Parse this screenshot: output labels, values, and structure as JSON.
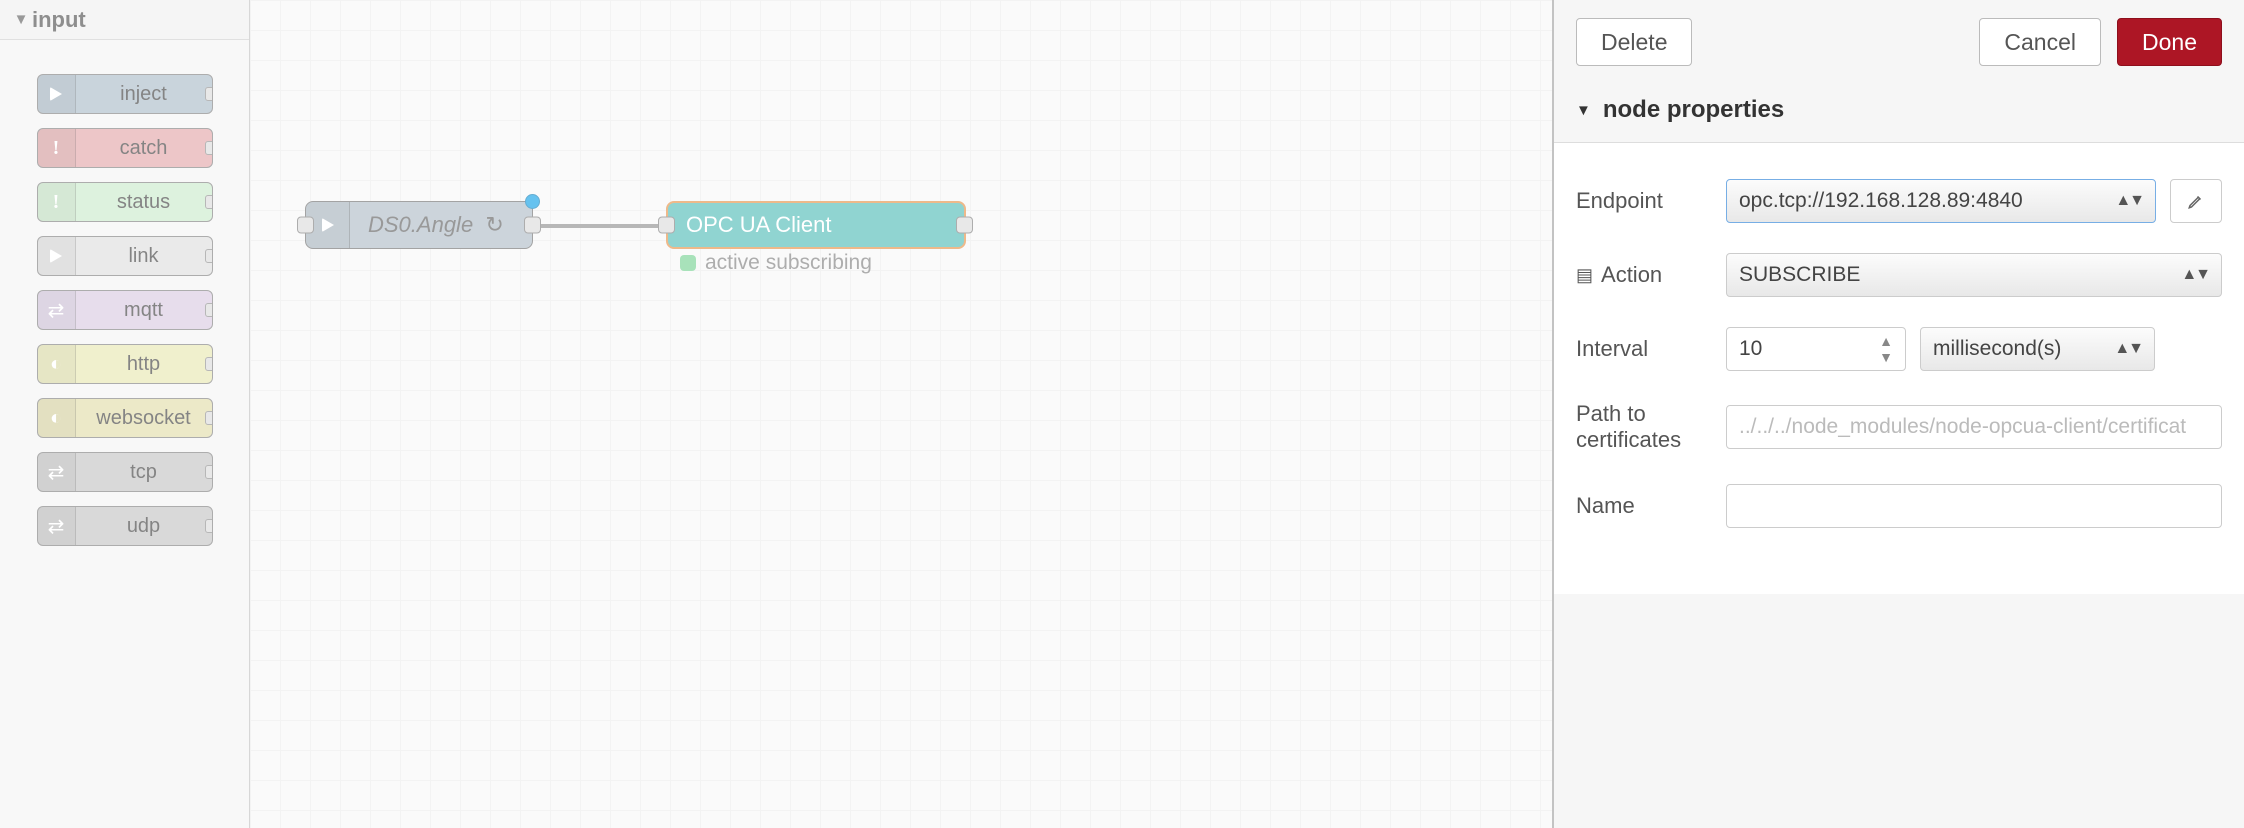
{
  "palette": {
    "category": "input",
    "nodes": [
      {
        "label": "inject",
        "color": "c-inject",
        "icon": "arrow"
      },
      {
        "label": "catch",
        "color": "c-catch",
        "icon": "bang"
      },
      {
        "label": "status",
        "color": "c-status",
        "icon": "bang"
      },
      {
        "label": "link",
        "color": "c-link",
        "icon": "arrow"
      },
      {
        "label": "mqtt",
        "color": "c-mqtt",
        "icon": "feed"
      },
      {
        "label": "http",
        "color": "c-http",
        "icon": "globe"
      },
      {
        "label": "websocket",
        "color": "c-websocket",
        "icon": "globe"
      },
      {
        "label": "tcp",
        "color": "c-tcp",
        "icon": "feed"
      },
      {
        "label": "udp",
        "color": "c-udp",
        "icon": "feed"
      }
    ]
  },
  "canvas": {
    "nodes": {
      "ds0": {
        "label": "DS0.Angle",
        "refresh_icon": "↻",
        "changed": true
      },
      "opcua": {
        "label": "OPC UA Client",
        "status_text": "active subscribing",
        "status_color": "#6fcf8c"
      }
    }
  },
  "panel": {
    "buttons": {
      "delete": "Delete",
      "cancel": "Cancel",
      "done": "Done"
    },
    "section_title": "node properties",
    "form": {
      "endpoint": {
        "label": "Endpoint",
        "value": "opc.tcp://192.168.128.89:4840"
      },
      "action": {
        "label": "Action",
        "value": "SUBSCRIBE"
      },
      "interval": {
        "label": "Interval",
        "value": "10",
        "unit": "millisecond(s)"
      },
      "certpath": {
        "label": "Path to certificates",
        "placeholder": "../../../node_modules/node-opcua-client/certificat",
        "value": ""
      },
      "name": {
        "label": "Name",
        "value": ""
      }
    }
  }
}
